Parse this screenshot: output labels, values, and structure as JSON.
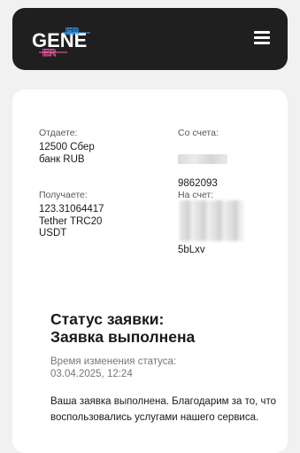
{
  "header": {
    "logo_text": "GENE",
    "logo_accent_text": "ER",
    "menu_icon": "hamburger-menu-icon"
  },
  "exchange": {
    "give": {
      "label": "Отдаете:",
      "value": "12500 Сбер\nбанк RUB"
    },
    "from_account": {
      "label": "Со счета:",
      "value_visible": "9862093"
    },
    "receive": {
      "label": "Получаете:",
      "value": "123.31064417\nTether TRC20\nUSDT"
    },
    "to_account": {
      "label": "На счет:",
      "value_visible": "5bLxv"
    }
  },
  "status": {
    "title": "Статус заявки:\nЗаявка выполнена",
    "time_label": "Время изменения статуса:",
    "time_value": "03.04.2025, 12:24",
    "message": "Ваша заявка выполнена. Благодарим за то, что воспользовались услугами нашего сервиса."
  },
  "colors": {
    "header_bg": "#1f1f1f",
    "page_bg": "#f1f1f1",
    "card_bg": "#ffffff",
    "logo_accent_blue": "#3aa5ff",
    "logo_accent_pink": "#ff5db1"
  }
}
